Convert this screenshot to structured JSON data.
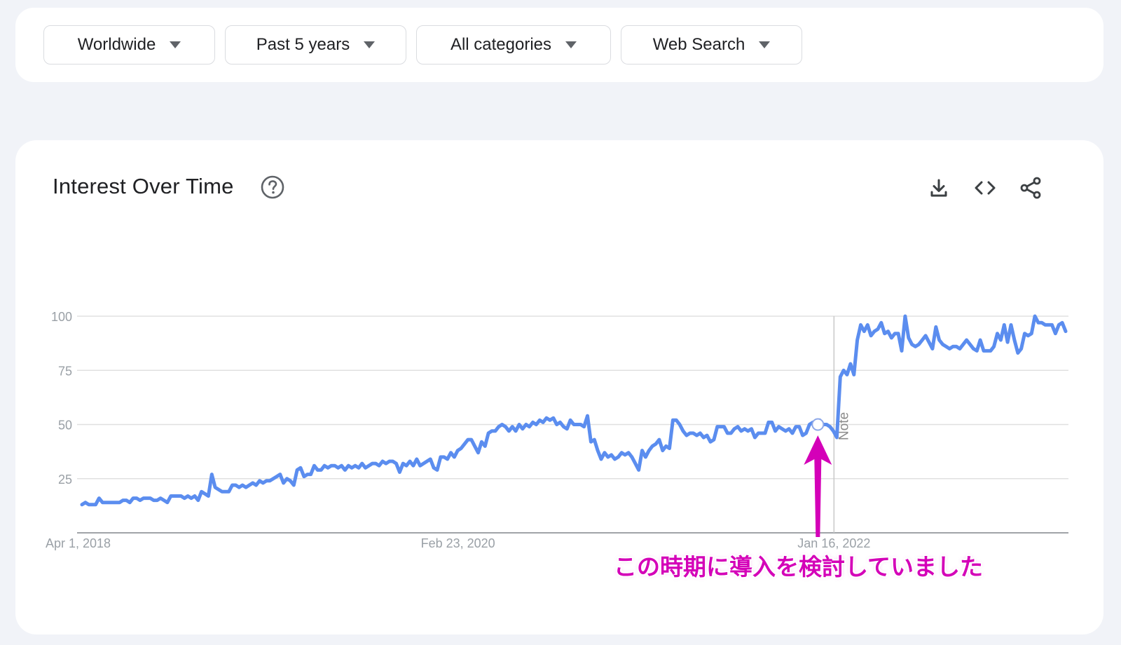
{
  "filters": {
    "region": "Worldwide",
    "time_range": "Past 5 years",
    "category": "All categories",
    "search_type": "Web Search"
  },
  "card": {
    "title": "Interest Over Time",
    "help_icon": "help-circle-icon",
    "actions": [
      "download-icon",
      "embed-code-icon",
      "share-icon"
    ]
  },
  "annotation": {
    "text": "この時期に導入を検討していました",
    "color": "#d400b8"
  },
  "chart_data": {
    "type": "line",
    "title": "",
    "xlabel": "",
    "ylabel": "",
    "ylim": [
      0,
      100
    ],
    "y_ticks": [
      "100",
      "75",
      "50",
      "25"
    ],
    "x_ticks": [
      "Apr 1, 2018",
      "Feb 23, 2020",
      "Jan 16, 2022"
    ],
    "x_range": [
      "2018-04-01",
      "2023-03-19"
    ],
    "note_label": "Note",
    "note_date": "2022-01-16",
    "line_color": "#5b8def",
    "grid": true,
    "series": [
      {
        "values": [
          13,
          14,
          13,
          13,
          13,
          16,
          14,
          14,
          14,
          14,
          14,
          14,
          15,
          15,
          14,
          16,
          16,
          15,
          16,
          16,
          16,
          15,
          15,
          16,
          15,
          14,
          17,
          17,
          17,
          17,
          16,
          17,
          16,
          17,
          15,
          19,
          18,
          17,
          27,
          21,
          20,
          19,
          19,
          19,
          22,
          22,
          21,
          22,
          21,
          22,
          23,
          22,
          24,
          23,
          24,
          24,
          25,
          26,
          27,
          23,
          25,
          24,
          22,
          29,
          30,
          26,
          27,
          27,
          31,
          29,
          29,
          31,
          30,
          31,
          31,
          30,
          31,
          29,
          31,
          30,
          31,
          30,
          32,
          30,
          31,
          32,
          32,
          31,
          33,
          32,
          33,
          33,
          32,
          28,
          32,
          31,
          33,
          31,
          34,
          31,
          32,
          33,
          34,
          30,
          29,
          35,
          35,
          34,
          37,
          35,
          38,
          39,
          41,
          43,
          43,
          40,
          37,
          42,
          40,
          46,
          47,
          47,
          49,
          50,
          49,
          47,
          49,
          47,
          50,
          48,
          50,
          49,
          51,
          50,
          52,
          51,
          53,
          52,
          53,
          50,
          51,
          49,
          48,
          52,
          50,
          50,
          50,
          49,
          54,
          42,
          43,
          38,
          34,
          37,
          35,
          36,
          34,
          35,
          37,
          36,
          37,
          35,
          32,
          29,
          38,
          35,
          38,
          40,
          41,
          43,
          38,
          40,
          39,
          52,
          52,
          50,
          47,
          45,
          46,
          46,
          45,
          46,
          44,
          45,
          42,
          43,
          49,
          49,
          49,
          46,
          46,
          48,
          49,
          47,
          48,
          47,
          48,
          44,
          46,
          46,
          46,
          51,
          51,
          47,
          49,
          48,
          47,
          48,
          46,
          49,
          49,
          45,
          46,
          50,
          51,
          51,
          52,
          50,
          50,
          49,
          47,
          44,
          72,
          75,
          73,
          78,
          73,
          89,
          96,
          93,
          96,
          91,
          93,
          94,
          97,
          92,
          93,
          90,
          92,
          92,
          84,
          100,
          90,
          87,
          86,
          87,
          89,
          91,
          88,
          85,
          95,
          89,
          87,
          86,
          85,
          86,
          86,
          85,
          87,
          89,
          87,
          85,
          84,
          89,
          84,
          84,
          84,
          86,
          92,
          89,
          96,
          88,
          96,
          89,
          83,
          85,
          92,
          91,
          92,
          100,
          97,
          97,
          96,
          96,
          96,
          92,
          96,
          97,
          93
        ]
      }
    ]
  }
}
